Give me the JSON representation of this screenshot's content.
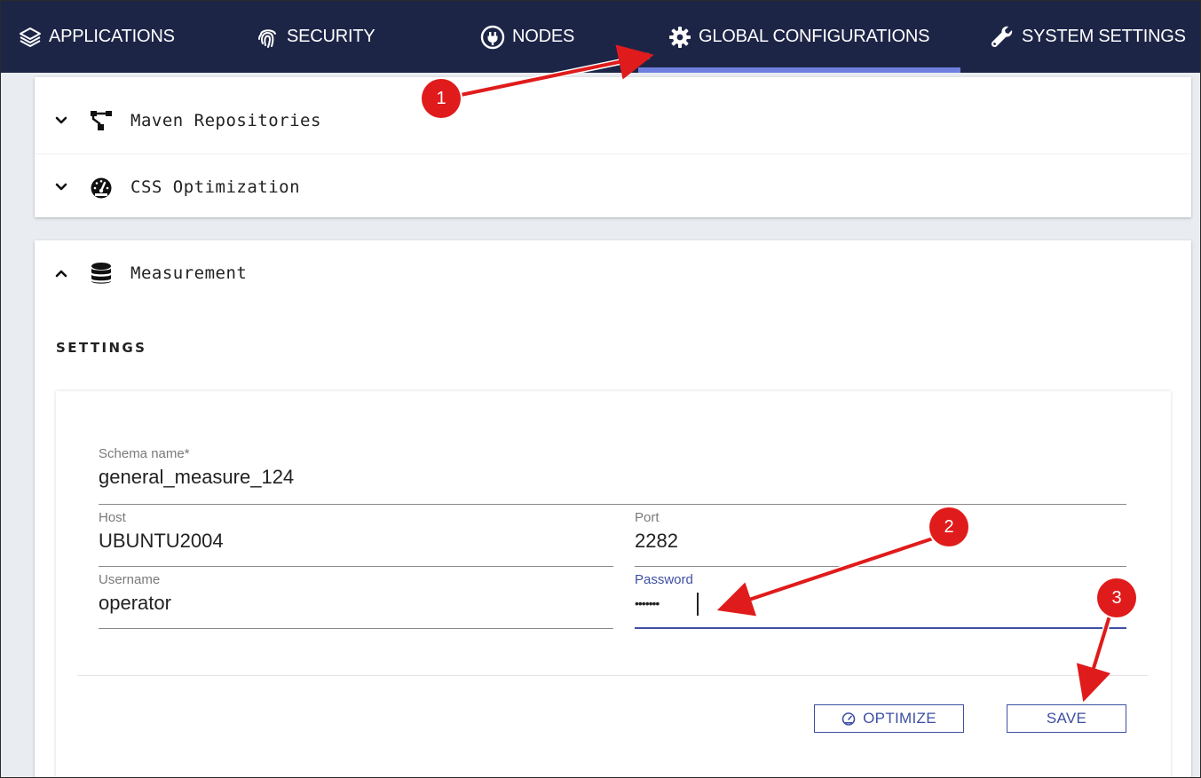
{
  "nav": {
    "items": [
      {
        "label": "APPLICATIONS",
        "icon": "layers-icon"
      },
      {
        "label": "SECURITY",
        "icon": "fingerprint-icon"
      },
      {
        "label": "NODES",
        "icon": "plug-icon"
      },
      {
        "label": "GLOBAL CONFIGURATIONS",
        "icon": "gear-icon",
        "active": true
      },
      {
        "label": "SYSTEM SETTINGS",
        "icon": "wrench-icon"
      }
    ]
  },
  "accordion": {
    "maven": {
      "title": "Maven Repositories",
      "icon": "sitemap-icon",
      "expanded": false
    },
    "css": {
      "title": "CSS Optimization",
      "icon": "gauge-icon",
      "expanded": false
    },
    "measurement": {
      "title": "Measurement",
      "icon": "database-icon",
      "expanded": true
    }
  },
  "settings": {
    "heading": "SETTINGS",
    "schema": {
      "label": "Schema name*",
      "value": "general_measure_124"
    },
    "host": {
      "label": "Host",
      "value": "UBUNTU2004"
    },
    "port": {
      "label": "Port",
      "value": "2282"
    },
    "username": {
      "label": "Username",
      "value": "operator"
    },
    "password": {
      "label": "Password",
      "value": "•••••••"
    }
  },
  "buttons": {
    "optimize": "OPTIMIZE",
    "save": "SAVE"
  },
  "annotations": {
    "badges": [
      "1",
      "2",
      "3"
    ]
  },
  "colors": {
    "nav_bg": "#1d2547",
    "accent": "#3e4fa3",
    "annotation_red": "#e01b1b"
  }
}
